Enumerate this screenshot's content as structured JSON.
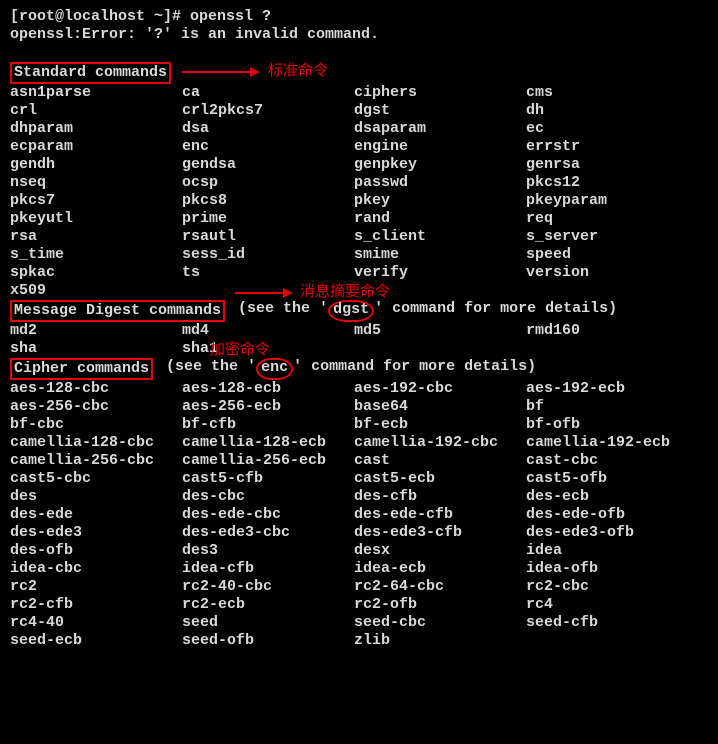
{
  "prompt_line": "[root@localhost ~]# openssl ?",
  "error_line": "openssl:Error: '?' is an invalid command.",
  "headers": {
    "standard": "Standard commands",
    "digest": "Message Digest commands",
    "digest_suffix_pre": " (see the '",
    "digest_key": "dgst",
    "digest_suffix_post": "' command for more details)",
    "cipher": "Cipher commands",
    "cipher_suffix_pre": " (see the '",
    "cipher_key": "enc",
    "cipher_suffix_post": "' command for more details)"
  },
  "annotations": {
    "standard": "标准命令",
    "digest": "消息摘要命令",
    "cipher": "加密命令"
  },
  "standard_cmds": [
    [
      "asn1parse",
      "ca",
      "ciphers",
      "cms"
    ],
    [
      "crl",
      "crl2pkcs7",
      "dgst",
      "dh"
    ],
    [
      "dhparam",
      "dsa",
      "dsaparam",
      "ec"
    ],
    [
      "ecparam",
      "enc",
      "engine",
      "errstr"
    ],
    [
      "gendh",
      "gendsa",
      "genpkey",
      "genrsa"
    ],
    [
      "nseq",
      "ocsp",
      "passwd",
      "pkcs12"
    ],
    [
      "pkcs7",
      "pkcs8",
      "pkey",
      "pkeyparam"
    ],
    [
      "pkeyutl",
      "prime",
      "rand",
      "req"
    ],
    [
      "rsa",
      "rsautl",
      "s_client",
      "s_server"
    ],
    [
      "s_time",
      "sess_id",
      "smime",
      "speed"
    ],
    [
      "spkac",
      "ts",
      "verify",
      "version"
    ],
    [
      "x509",
      "",
      "",
      ""
    ]
  ],
  "digest_cmds": [
    [
      "md2",
      "md4",
      "md5",
      "rmd160"
    ],
    [
      "sha",
      "sha1",
      "",
      ""
    ]
  ],
  "cipher_cmds": [
    [
      "aes-128-cbc",
      "aes-128-ecb",
      "aes-192-cbc",
      "aes-192-ecb"
    ],
    [
      "aes-256-cbc",
      "aes-256-ecb",
      "base64",
      "bf"
    ],
    [
      "bf-cbc",
      "bf-cfb",
      "bf-ecb",
      "bf-ofb"
    ],
    [
      "camellia-128-cbc",
      "camellia-128-ecb",
      "camellia-192-cbc",
      "camellia-192-ecb"
    ],
    [
      "camellia-256-cbc",
      "camellia-256-ecb",
      "cast",
      "cast-cbc"
    ],
    [
      "cast5-cbc",
      "cast5-cfb",
      "cast5-ecb",
      "cast5-ofb"
    ],
    [
      "des",
      "des-cbc",
      "des-cfb",
      "des-ecb"
    ],
    [
      "des-ede",
      "des-ede-cbc",
      "des-ede-cfb",
      "des-ede-ofb"
    ],
    [
      "des-ede3",
      "des-ede3-cbc",
      "des-ede3-cfb",
      "des-ede3-ofb"
    ],
    [
      "des-ofb",
      "des3",
      "desx",
      "idea"
    ],
    [
      "idea-cbc",
      "idea-cfb",
      "idea-ecb",
      "idea-ofb"
    ],
    [
      "rc2",
      "rc2-40-cbc",
      "rc2-64-cbc",
      "rc2-cbc"
    ],
    [
      "rc2-cfb",
      "rc2-ecb",
      "rc2-ofb",
      "rc4"
    ],
    [
      "rc4-40",
      "seed",
      "seed-cbc",
      "seed-cfb"
    ],
    [
      "seed-ecb",
      "seed-ofb",
      "zlib",
      ""
    ]
  ]
}
